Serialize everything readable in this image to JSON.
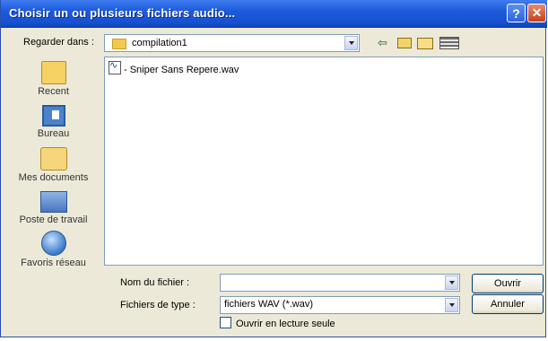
{
  "window": {
    "title": "Choisir un ou plusieurs fichiers audio..."
  },
  "titlebar_buttons": {
    "help": "?",
    "close": "✕"
  },
  "lookin": {
    "label": "Regarder dans :",
    "value": "compilation1"
  },
  "toolbar": {
    "back": "⇦"
  },
  "places": [
    {
      "label": "Recent",
      "icon": "recent-folder-icon"
    },
    {
      "label": "Bureau",
      "icon": "desktop-icon"
    },
    {
      "label": "Mes documents",
      "icon": "documents-folder-icon"
    },
    {
      "label": "Poste de travail",
      "icon": "my-computer-icon"
    },
    {
      "label": "Favoris réseau",
      "icon": "network-icon"
    }
  ],
  "files": [
    {
      "name": "- Sniper Sans Repere.wav",
      "icon": "wav-file-icon"
    }
  ],
  "filename": {
    "label": "Nom du fichier :",
    "value": ""
  },
  "filetype": {
    "label": "Fichiers de type :",
    "value": "fichiers WAV (*.wav)"
  },
  "buttons": {
    "open": "Ouvrir",
    "cancel": "Annuler"
  },
  "readonly": {
    "label": "Ouvrir en lecture seule",
    "checked": false
  }
}
